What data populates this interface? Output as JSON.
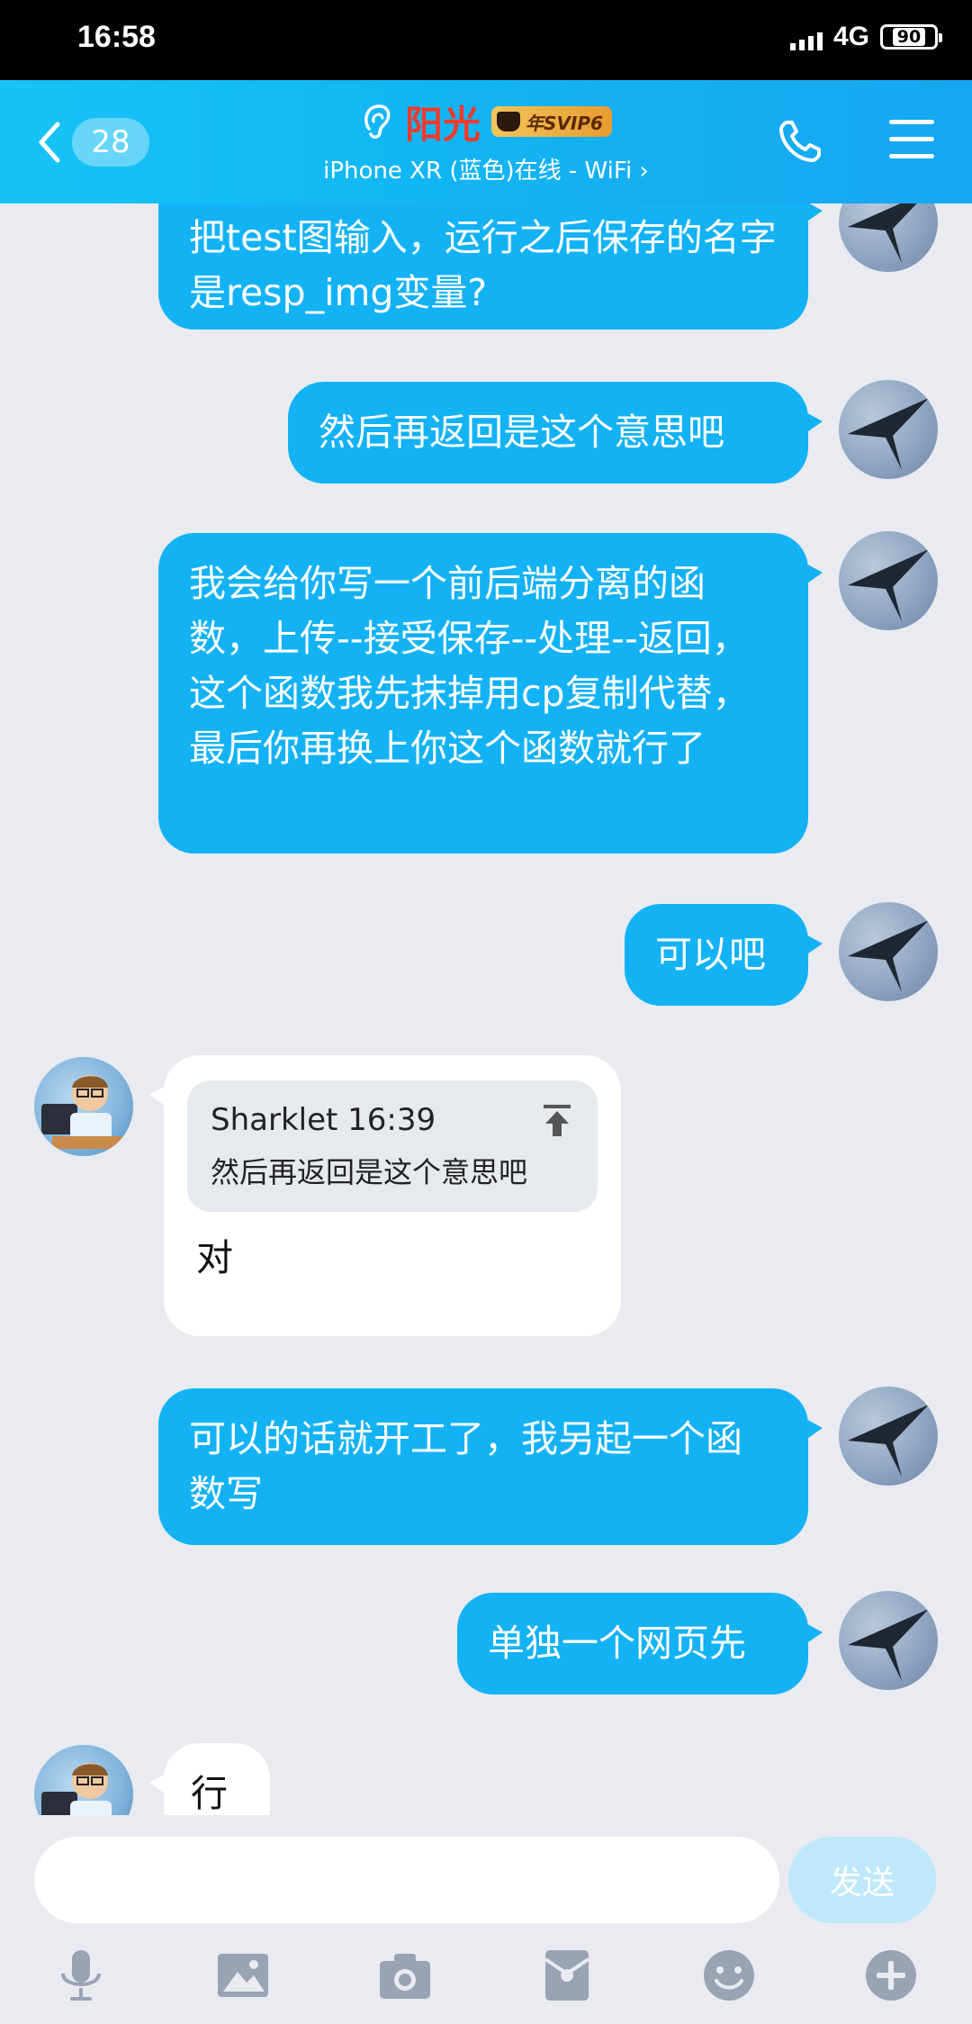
{
  "status_bar": {
    "time": "16:58",
    "network": "4G",
    "battery": "90"
  },
  "header": {
    "unread_count": "28",
    "contact_name": "阳光",
    "vip_label": "年SVIP6",
    "status": "iPhone XR (蓝色)在线 - WiFi ›"
  },
  "messages": [
    {
      "side": "out",
      "text": "把test图输入，运行之后保存的名字是resp_img变量?"
    },
    {
      "side": "out",
      "text": "然后再返回是这个意思吧"
    },
    {
      "side": "out",
      "text": "我会给你写一个前后端分离的函数，上传--接受保存--处理--返回，这个函数我先抹掉用cp复制代替，最后你再换上你这个函数就行了"
    },
    {
      "side": "out",
      "text": "可以吧"
    },
    {
      "side": "in",
      "quote_sender": "Sharklet 16:39",
      "quote_text": "然后再返回是这个意思吧",
      "text": "对"
    },
    {
      "side": "out",
      "text": "可以的话就开工了，我另起一个函数写"
    },
    {
      "side": "out",
      "text": "单独一个网页先"
    },
    {
      "side": "in",
      "text": "行"
    }
  ],
  "input": {
    "placeholder": "",
    "send_label": "发送"
  },
  "toolbar": [
    "mic-icon",
    "image-icon",
    "camera-icon",
    "red-packet-icon",
    "emoji-icon",
    "plus-icon"
  ],
  "colors": {
    "header": "#13b2f5",
    "bubble_out": "#13b2f5",
    "bubble_in": "#ffffff",
    "background": "#e9ebf1",
    "name": "#ef3b2d"
  }
}
